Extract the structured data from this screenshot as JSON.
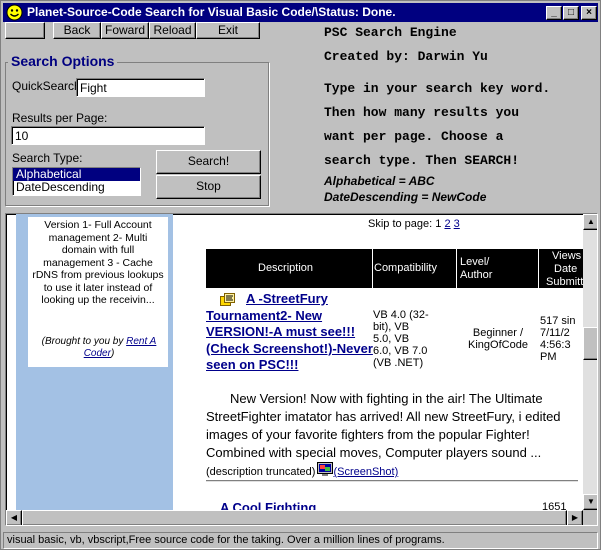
{
  "window": {
    "title": "Planet-Source-Code Search for Visual Basic Code/\\Status: Done."
  },
  "nav": {
    "back": "Back",
    "forward": "Foward",
    "reload": "Reload",
    "exit": "Exit"
  },
  "search": {
    "group_title": "Search Options",
    "quicksearch_label": "QuickSearch:",
    "quicksearch_value": "Fight",
    "results_label": "Results per Page:",
    "results_value": "10",
    "type_label": "Search Type:",
    "types": [
      "Alphabetical",
      "DateDescending"
    ],
    "selected_type": "Alphabetical",
    "search_button": "Search!",
    "stop_button": "Stop"
  },
  "info": {
    "line1": "PSC Search Engine",
    "line2": "Created by: Darwin Yu",
    "line3": "Type in your search key word.",
    "line4": "Then how many results you",
    "line5": "want per page. Choose a",
    "line6": "search type. Then SEARCH!",
    "line7": "Alphabetical = ABC",
    "line8": "DateDescending = NewCode"
  },
  "browser": {
    "left_card": "Version 1- Full Account management 2- Multi domain with full management 3 - Cache rDNS from previous lookups to use it later instead of looking up the receivin...",
    "brought_prefix": "(Brought to you by",
    "brought_link": "Rent A Coder",
    "brought_suffix": ")",
    "skip_label": "Skip to page:",
    "pages": [
      "1",
      "2",
      "3"
    ],
    "headers": {
      "description": "Description",
      "compatibility": "Compatibility",
      "level": "Level/",
      "author": "Author",
      "views": "Views",
      "date": "Date",
      "submitted": "Submitt"
    },
    "row": {
      "title_line1": "A -StreetFury",
      "title_rest": "Tournament2- New VERSION!-A must see!!!(Check Screenshot!)-Never seen on PSC!!!",
      "compat_lines": [
        "VB 4.0 (32-",
        "bit), VB",
        "5.0, VB",
        "6.0, VB 7.0",
        "(VB .NET)"
      ],
      "level_line1": "Beginner /",
      "level_line2": "KingOfCode",
      "views_lines": [
        "517 sin",
        "7/11/2",
        "4:56:3",
        "PM"
      ],
      "description": "New Version! Now with fighting in the air! The Ultimate StreetFighter imatator has arrived! All new StreetFury, i edited images of your favorite fighters from the popular Fighter! Combined with special moves, Computer players sound ...",
      "truncated": "(description truncated)",
      "screenshot": "(ScreenShot)"
    },
    "next_row_partial": "A Cool Fighting",
    "next_views_partial": "1651"
  },
  "status": "visual basic, vb, vbscript,Free source code for the taking. Over a million lines of programs."
}
